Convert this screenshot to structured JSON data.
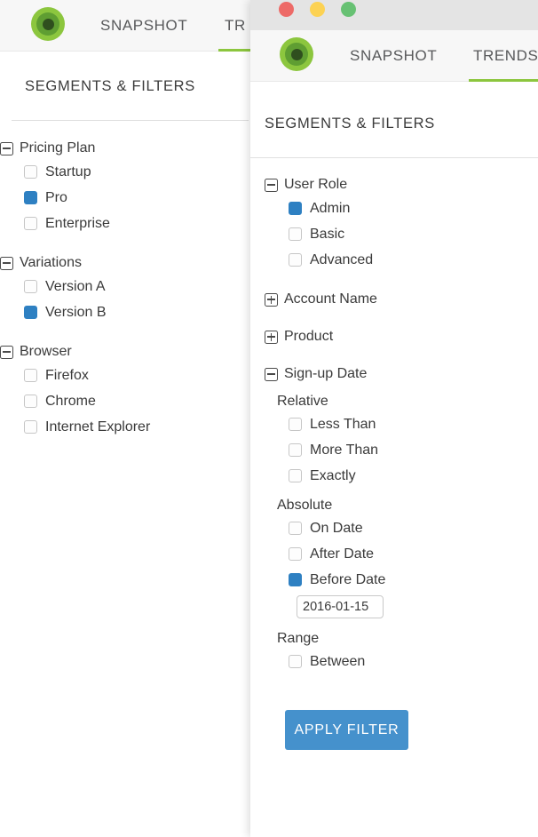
{
  "background_window": {
    "nav": {
      "logo_icon": "target-circles-logo-icon",
      "tabs": [
        {
          "label": "SNAPSHOT",
          "active": false
        },
        {
          "label": "TR",
          "active": true
        }
      ]
    },
    "panel": {
      "title": "SEGMENTS & FILTERS",
      "groups": [
        {
          "label": "Pricing Plan",
          "expanded": true,
          "toggle_icon": "minus-box-icon",
          "options": [
            {
              "label": "Startup",
              "checked": false
            },
            {
              "label": "Pro",
              "checked": true
            },
            {
              "label": "Enterprise",
              "checked": false
            }
          ]
        },
        {
          "label": "Variations",
          "expanded": true,
          "toggle_icon": "minus-box-icon",
          "options": [
            {
              "label": "Version A",
              "checked": false
            },
            {
              "label": "Version B",
              "checked": true
            }
          ]
        },
        {
          "label": "Browser",
          "expanded": true,
          "toggle_icon": "minus-box-icon",
          "options": [
            {
              "label": "Firefox",
              "checked": false
            },
            {
              "label": "Chrome",
              "checked": false
            },
            {
              "label": "Internet Explorer",
              "checked": false
            }
          ]
        }
      ]
    }
  },
  "foreground_window": {
    "titlebar": {
      "close_label": "",
      "minimize_label": "",
      "maximize_label": "",
      "colors": {
        "close": "#ed6a67",
        "minimize": "#fcd253",
        "maximize": "#67c173"
      }
    },
    "nav": {
      "logo_icon": "target-circles-logo-icon",
      "tabs": [
        {
          "label": "SNAPSHOT",
          "active": false
        },
        {
          "label": "TRENDS",
          "active": true
        }
      ]
    },
    "panel": {
      "title": "SEGMENTS & FILTERS",
      "groups": [
        {
          "label": "User Role",
          "expanded": true,
          "toggle_icon": "minus-box-icon",
          "options": [
            {
              "label": "Admin",
              "checked": true
            },
            {
              "label": "Basic",
              "checked": false
            },
            {
              "label": "Advanced",
              "checked": false
            }
          ]
        },
        {
          "label": "Account Name",
          "expanded": false,
          "toggle_icon": "plus-box-icon",
          "options": []
        },
        {
          "label": "Product",
          "expanded": false,
          "toggle_icon": "plus-box-icon",
          "options": []
        },
        {
          "label": "Sign-up Date",
          "expanded": true,
          "toggle_icon": "minus-box-icon",
          "subsections": [
            {
              "heading": "Relative",
              "options": [
                {
                  "label": "Less Than",
                  "checked": false
                },
                {
                  "label": "More Than",
                  "checked": false
                },
                {
                  "label": "Exactly",
                  "checked": false
                }
              ]
            },
            {
              "heading": "Absolute",
              "options": [
                {
                  "label": "On Date",
                  "checked": false
                },
                {
                  "label": "After Date",
                  "checked": false
                },
                {
                  "label": "Before Date",
                  "checked": true,
                  "input_value": "2016-01-15"
                }
              ]
            },
            {
              "heading": "Range",
              "options": [
                {
                  "label": "Between",
                  "checked": false
                }
              ]
            }
          ]
        }
      ],
      "apply_button_label": "APPLY FILTER"
    }
  },
  "theme": {
    "accent_green": "#8cc63e",
    "accent_blue": "#2e80c2",
    "button_blue": "#4591cc",
    "text": "#3a3a3a",
    "titlebar_bg": "#e4e4e4",
    "topbar_bg": "#f7f7f7"
  }
}
